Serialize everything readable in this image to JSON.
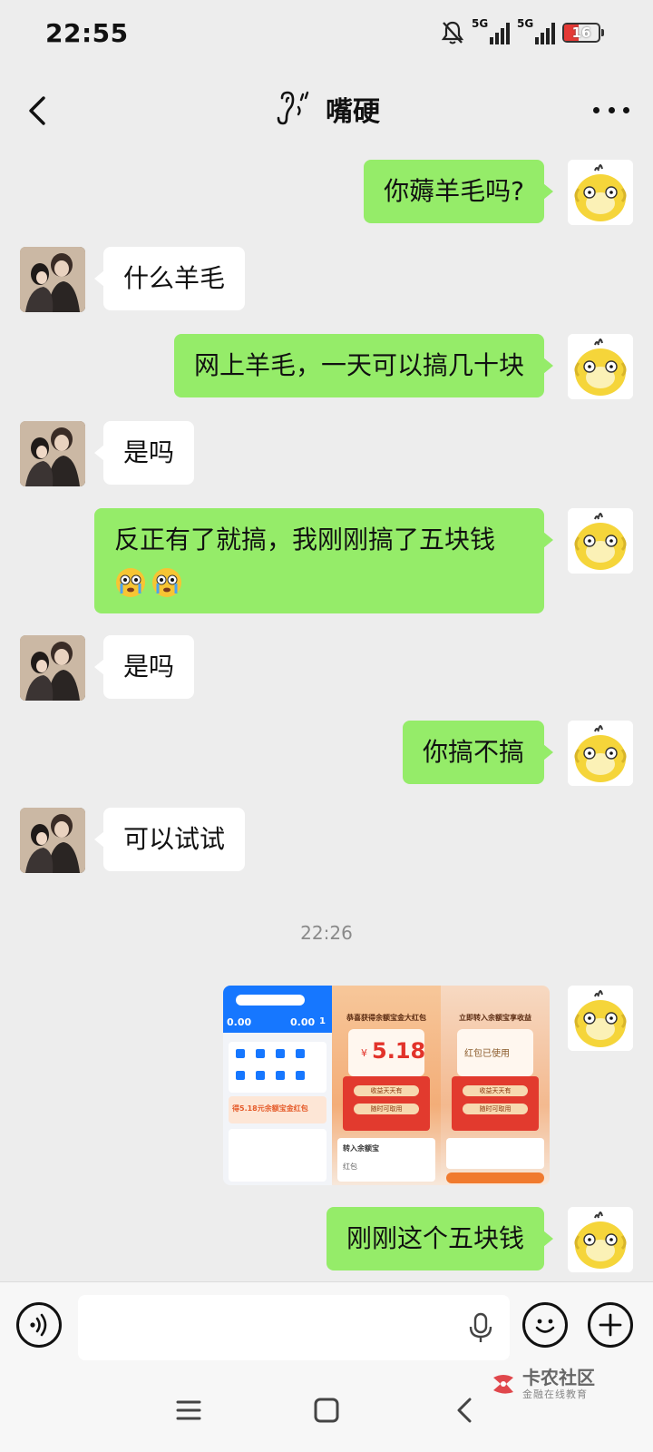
{
  "status_bar": {
    "time": "22:55",
    "signal_1_label": "5G",
    "signal_2_label": "5G",
    "battery_level": "16",
    "battery_color": "#e53935"
  },
  "header": {
    "title": "嘴硬",
    "back_icon": "chevron-left-icon",
    "listen_icon": "ear-icon",
    "more_icon": "more-dots-icon"
  },
  "messages": [
    {
      "from": "self",
      "text": "你薅羊毛吗?"
    },
    {
      "from": "other",
      "text": "什么羊毛"
    },
    {
      "from": "self",
      "text": "网上羊毛，一天可以搞几十块"
    },
    {
      "from": "other",
      "text": "是吗"
    },
    {
      "from": "self",
      "text_line1": "反正有了就搞，我刚刚搞了五块钱",
      "emoji": "crying-face-icon"
    },
    {
      "from": "other",
      "text": "是吗"
    },
    {
      "from": "self",
      "text": "你搞不搞"
    },
    {
      "from": "other",
      "text": "可以试试"
    },
    {
      "from": "self",
      "type": "image"
    },
    {
      "from": "self",
      "text": "刚刚这个五块钱"
    }
  ],
  "timestamp": "22:26",
  "image_message": {
    "panel1": {
      "balance_left": "0.00",
      "balance_right": "0.00",
      "small_right": "1",
      "promo": "得5.18元余额宝金红包"
    },
    "panel2": {
      "headline": "恭喜获得余额宝金大红包",
      "amount": "5.18",
      "currency": "¥",
      "btn_1": "收益天天有",
      "btn_2": "随时可取用",
      "row_label": "转入余额宝",
      "row_sub": "红包"
    },
    "panel3": {
      "headline": "立即转入余额宝享收益",
      "status": "红包已使用",
      "btn_1": "收益天天有",
      "btn_2": "随时可取用"
    }
  },
  "input_bar": {
    "placeholder": "",
    "voice_icon": "voice-mode-icon",
    "mic_icon": "microphone-icon",
    "emoji_icon": "smiley-icon",
    "plus_icon": "plus-icon"
  },
  "nav_bar": {
    "menu_icon": "menu-icon",
    "home_icon": "home-icon",
    "back_icon": "back-icon"
  },
  "watermark": {
    "name": "卡农社区",
    "subtitle": "金融在线教育"
  },
  "colors": {
    "chat_bg": "#ededed",
    "outgoing_bubble": "#95ec69",
    "incoming_bubble": "#ffffff",
    "duck_yellow": "#f5d53a"
  }
}
